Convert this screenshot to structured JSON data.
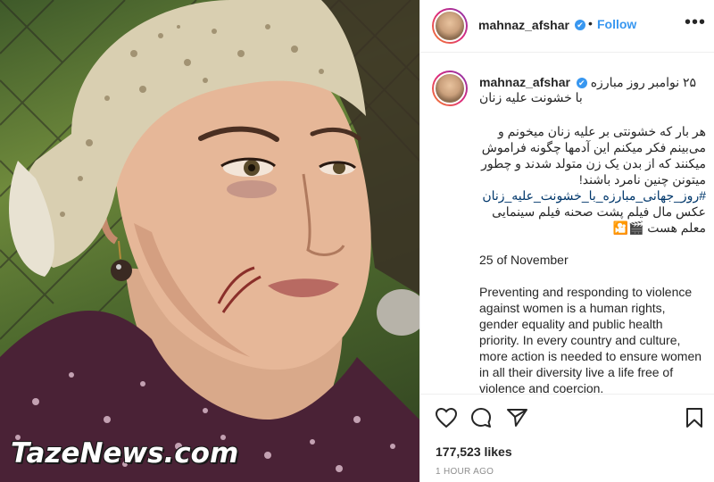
{
  "post": {
    "username": "mahnaz_afshar",
    "follow_label": "Follow",
    "more_label": "•••",
    "dot": "•",
    "verified_glyph": "✔",
    "watermark": "TazeNews.com",
    "avatar_icon": "profile-avatar-icon"
  },
  "caption": {
    "username": "mahnaz_afshar",
    "title": "۲۵ نوامبر روز مبارزه با خشونت علیه زنان",
    "paragraph_fa": "هر بار که خشونتی بر علیه زنان میخونم و می‌بینم فکر میکنم این آدمها چگونه فراموش میکنند که از بدن یک زن متولد شدند و چطور میتونن چنین نامرد باشند!",
    "hashtag": "#روز_جهانی_مبارزه_با_خشونت_علیه_زنان",
    "photo_note": "عکس مال فیلم پشت صحنه فیلم سینمایی معلم هست 🎬🎦",
    "date_line": "25 of November",
    "paragraph_en": "Preventing and responding to violence against women is a human rights, gender equality and public health priority. In every country and culture, more action is needed to ensure women in all their diversity live a life free of violence and coercion."
  },
  "actions": {
    "like_icon": "heart-icon",
    "comment_icon": "comment-icon",
    "share_icon": "share-icon",
    "save_icon": "bookmark-icon",
    "likes_count": "177,523 likes",
    "time_ago": "1 HOUR AGO"
  },
  "colors": {
    "link_blue": "#3897f0",
    "hashtag_blue": "#00376b",
    "text": "#262626",
    "muted": "#8e8e8e",
    "border": "#efefef"
  }
}
